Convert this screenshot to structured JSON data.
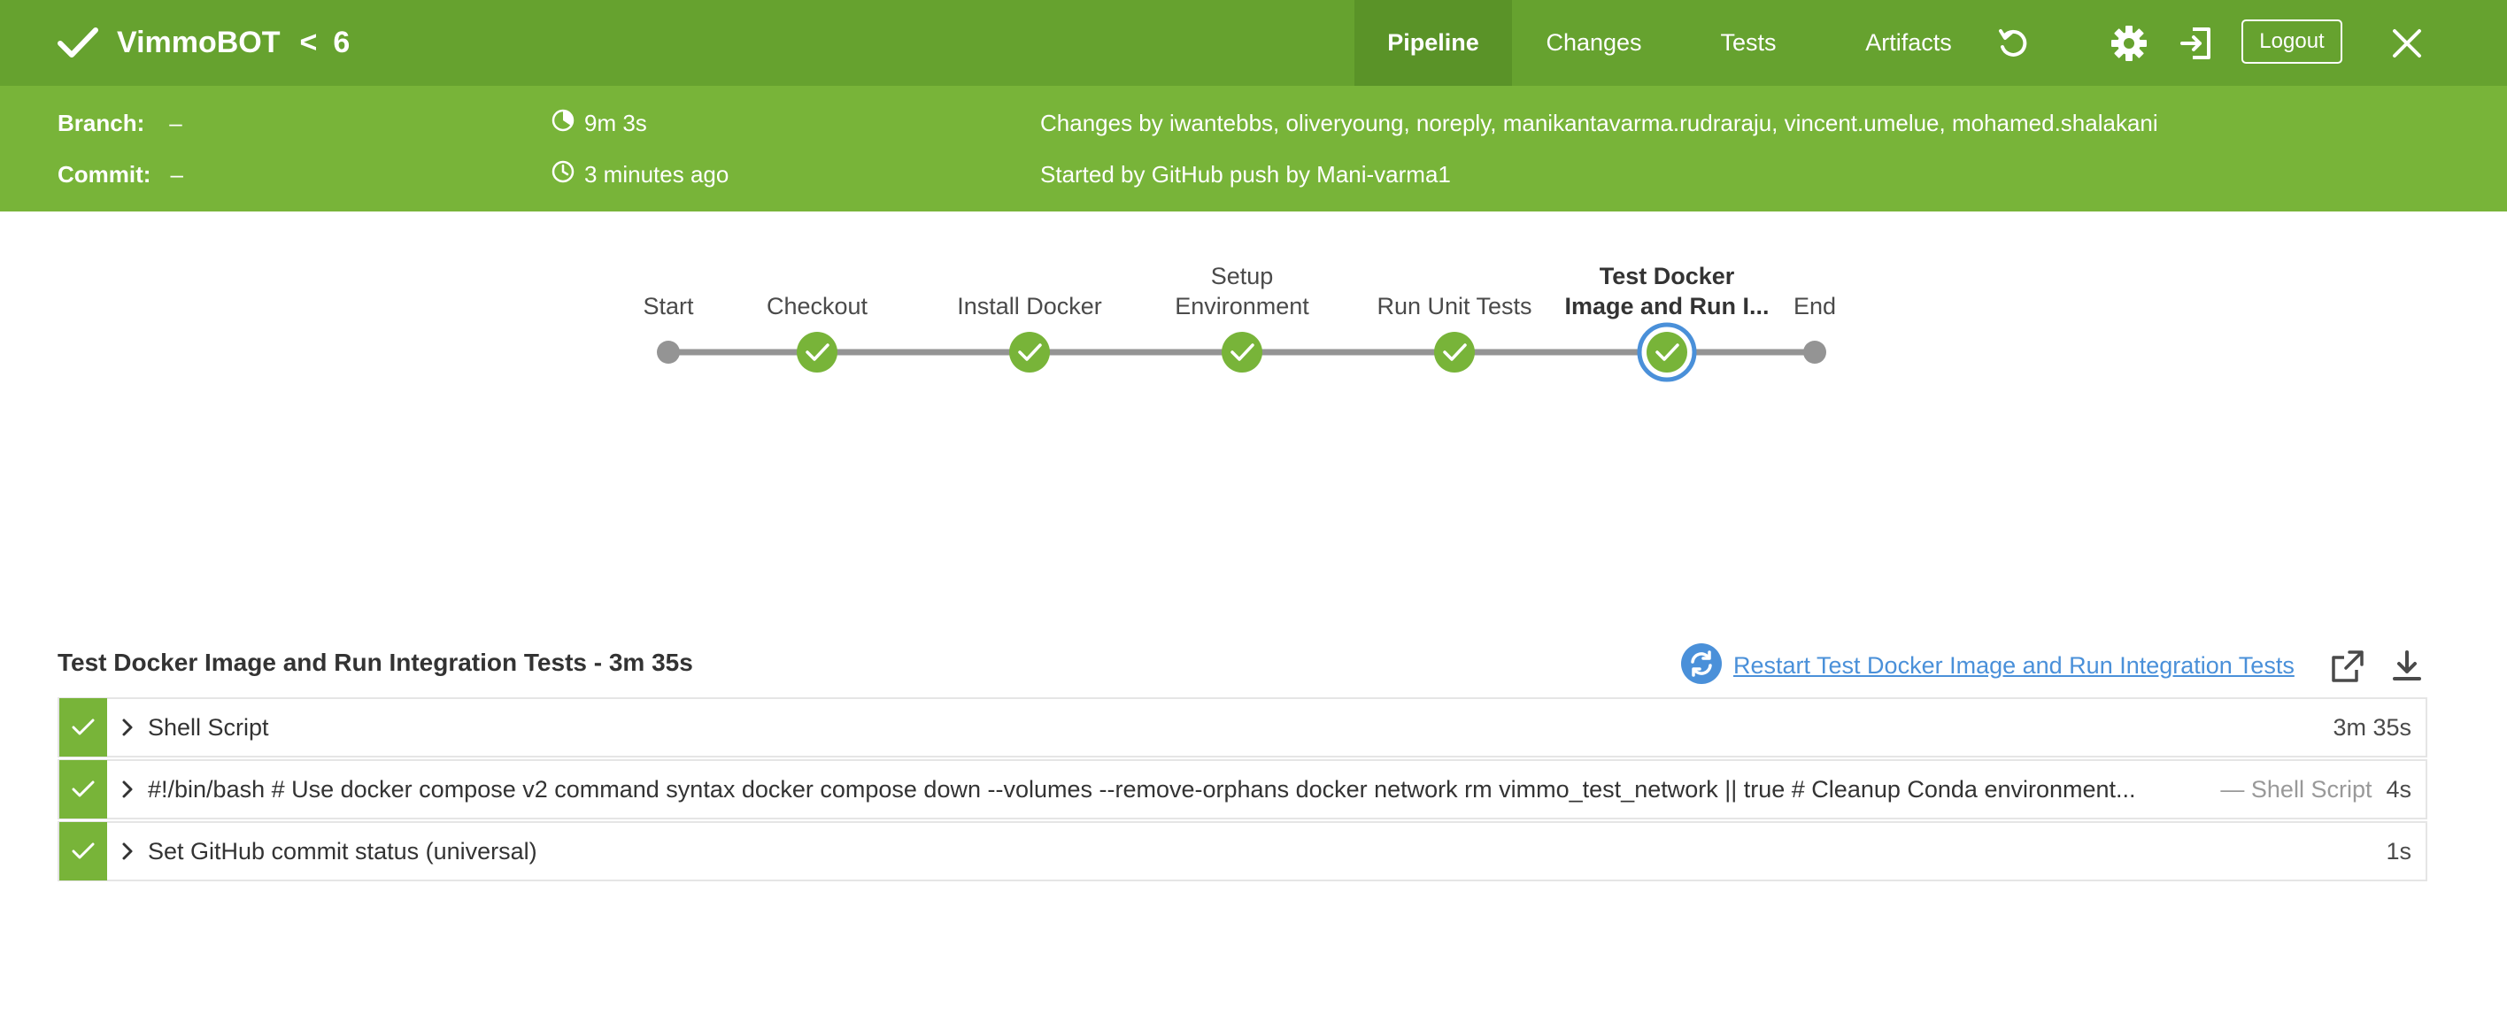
{
  "header": {
    "app_name": "VimmoBOT",
    "separator": "<",
    "run_number": "6",
    "tabs": [
      {
        "label": "Pipeline",
        "active": true
      },
      {
        "label": "Changes",
        "active": false
      },
      {
        "label": "Tests",
        "active": false
      },
      {
        "label": "Artifacts",
        "active": false
      }
    ],
    "logout_label": "Logout",
    "icons": [
      "check-icon",
      "replay-icon",
      "gear-icon",
      "exit-icon",
      "close-icon"
    ]
  },
  "summary": {
    "branch_label": "Branch:",
    "branch_value": "–",
    "commit_label": "Commit:",
    "commit_value": "–",
    "duration": "9m 3s",
    "started_ago": "3 minutes ago",
    "changes_by": "Changes by iwantebbs, oliveryoung, noreply, manikantavarma.rudraraju, vincent.umelue, mohamed.shalakani",
    "started_by": "Started by GitHub push by Mani-varma1"
  },
  "pipeline": {
    "stages": [
      {
        "line1": "",
        "line2": "Start",
        "status": "none"
      },
      {
        "line1": "",
        "line2": "Checkout",
        "status": "success"
      },
      {
        "line1": "",
        "line2": "Install Docker",
        "status": "success"
      },
      {
        "line1": "Setup",
        "line2": "Environment",
        "status": "success"
      },
      {
        "line1": "",
        "line2": "Run Unit Tests",
        "status": "success"
      },
      {
        "line1": "Test Docker",
        "line2": "Image and Run I...",
        "status": "success",
        "selected": true
      },
      {
        "line1": "",
        "line2": "End",
        "status": "none"
      }
    ]
  },
  "steps": {
    "title": "Test Docker Image and Run Integration Tests - 3m 35s",
    "restart_label": "Restart Test Docker Image and Run Integration Tests",
    "rows": [
      {
        "text": "Shell Script",
        "meta": "",
        "duration": "3m 35s"
      },
      {
        "text": "#!/bin/bash # Use docker compose v2 command syntax docker compose down --volumes --remove-orphans docker network rm vimmo_test_network || true # Cleanup Conda environment...",
        "meta": "— Shell Script",
        "duration": "4s"
      },
      {
        "text": "Set GitHub commit status (universal)",
        "meta": "",
        "duration": "1s"
      }
    ]
  },
  "colors": {
    "topbar": "#66a22f",
    "subheader": "#78b439",
    "success": "#78b439",
    "link": "#4a90d9",
    "selected_ring": "#4a90d9"
  }
}
